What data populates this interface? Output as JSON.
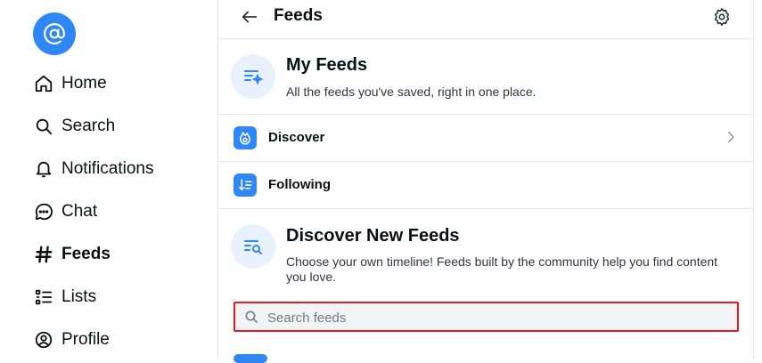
{
  "sidebar": {
    "avatar_symbol": "@",
    "items": [
      {
        "label": "Home",
        "icon": "home-icon"
      },
      {
        "label": "Search",
        "icon": "search-icon"
      },
      {
        "label": "Notifications",
        "icon": "bell-icon"
      },
      {
        "label": "Chat",
        "icon": "chat-icon"
      },
      {
        "label": "Feeds",
        "icon": "hash-icon",
        "active": true
      },
      {
        "label": "Lists",
        "icon": "list-icon"
      },
      {
        "label": "Profile",
        "icon": "profile-icon"
      }
    ]
  },
  "header": {
    "title": "Feeds"
  },
  "my_feeds": {
    "title": "My Feeds",
    "description": "All the feeds you've saved, right in one place."
  },
  "feeds": [
    {
      "label": "Discover",
      "icon": "discover-feed-icon"
    },
    {
      "label": "Following",
      "icon": "following-feed-icon"
    }
  ],
  "discover_new": {
    "title": "Discover New Feeds",
    "description": "Choose your own timeline! Feeds built by the community help you find content you love."
  },
  "search": {
    "placeholder": "Search feeds",
    "value": ""
  },
  "colors": {
    "accent": "#2f86f5",
    "highlight": "#e01b24",
    "icon_bg": "#e8f1fd"
  }
}
